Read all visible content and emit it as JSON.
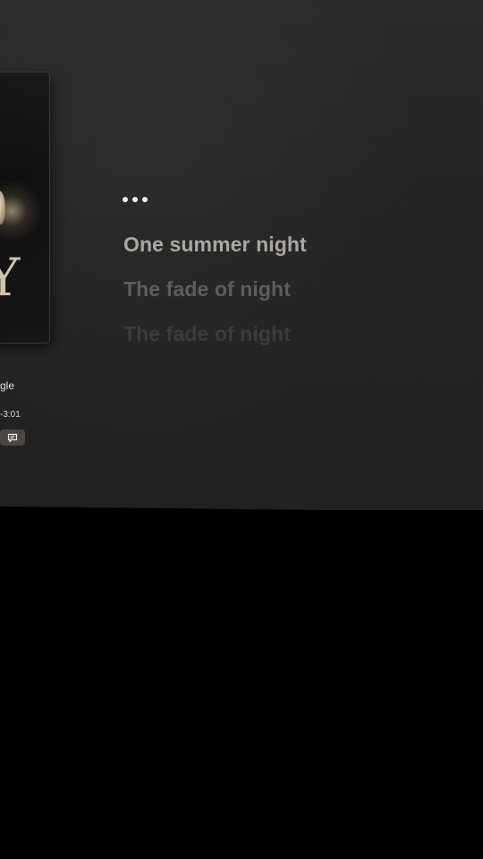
{
  "player": {
    "track_title": "gle",
    "time_remaining": "-3:01",
    "lyrics_button_icon": "speech-bubble-icon"
  },
  "lyrics": {
    "indicator": "ellipsis-dots",
    "lines": [
      "One summer night",
      "The fade of night",
      "The fade of night"
    ]
  },
  "colors": {
    "background": "#262423",
    "lyric_active": "#a9a5a1",
    "lyric_next": "#5d5a57",
    "lyric_faded": "#3c3a38",
    "dots": "#f3efe9",
    "button_bg": "#4a4745"
  }
}
